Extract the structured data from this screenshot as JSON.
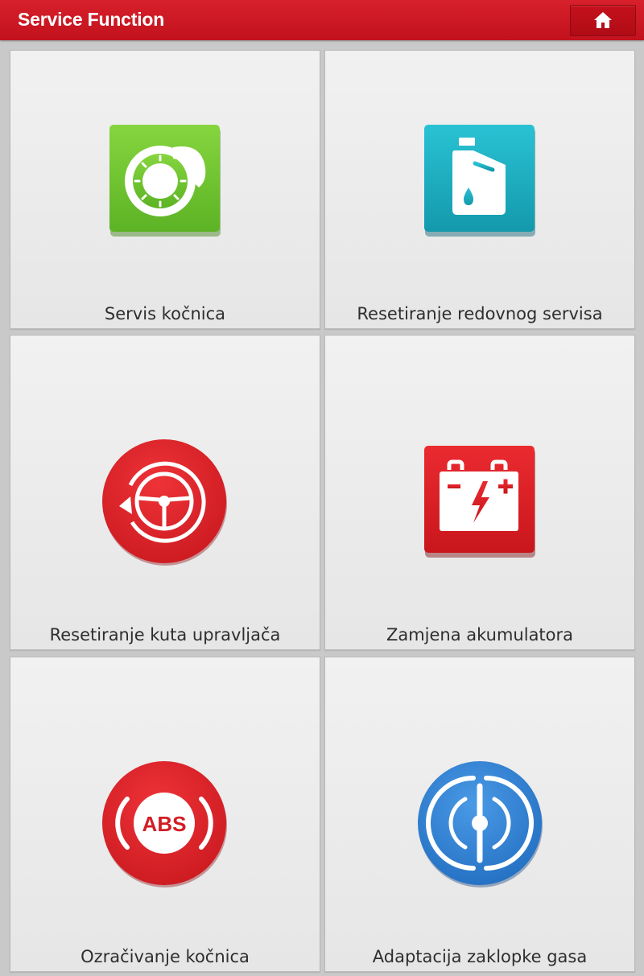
{
  "header": {
    "title": "Service Function",
    "home_icon": "home-icon"
  },
  "tiles": [
    {
      "label": "Servis kočnica",
      "icon": "brake-disc-icon",
      "color": "#6fc52e"
    },
    {
      "label": "Resetiranje redovnog servisa",
      "icon": "oil-canister-icon",
      "color": "#1fb1c4"
    },
    {
      "label": "Resetiranje kuta upravljača",
      "icon": "steering-angle-icon",
      "color": "#e0262c"
    },
    {
      "label": "Zamjena akumulatora",
      "icon": "battery-icon",
      "color": "#df2027"
    },
    {
      "label": "Ozračivanje kočnica",
      "icon": "abs-bleeding-icon",
      "color": "#df2027"
    },
    {
      "label": "Adaptacija zaklopke gasa",
      "icon": "throttle-icon",
      "color": "#2f86d8"
    }
  ],
  "colors": {
    "header": "#d11a25",
    "tile_background": "#ececec",
    "label_text": "#2e2e2e"
  }
}
